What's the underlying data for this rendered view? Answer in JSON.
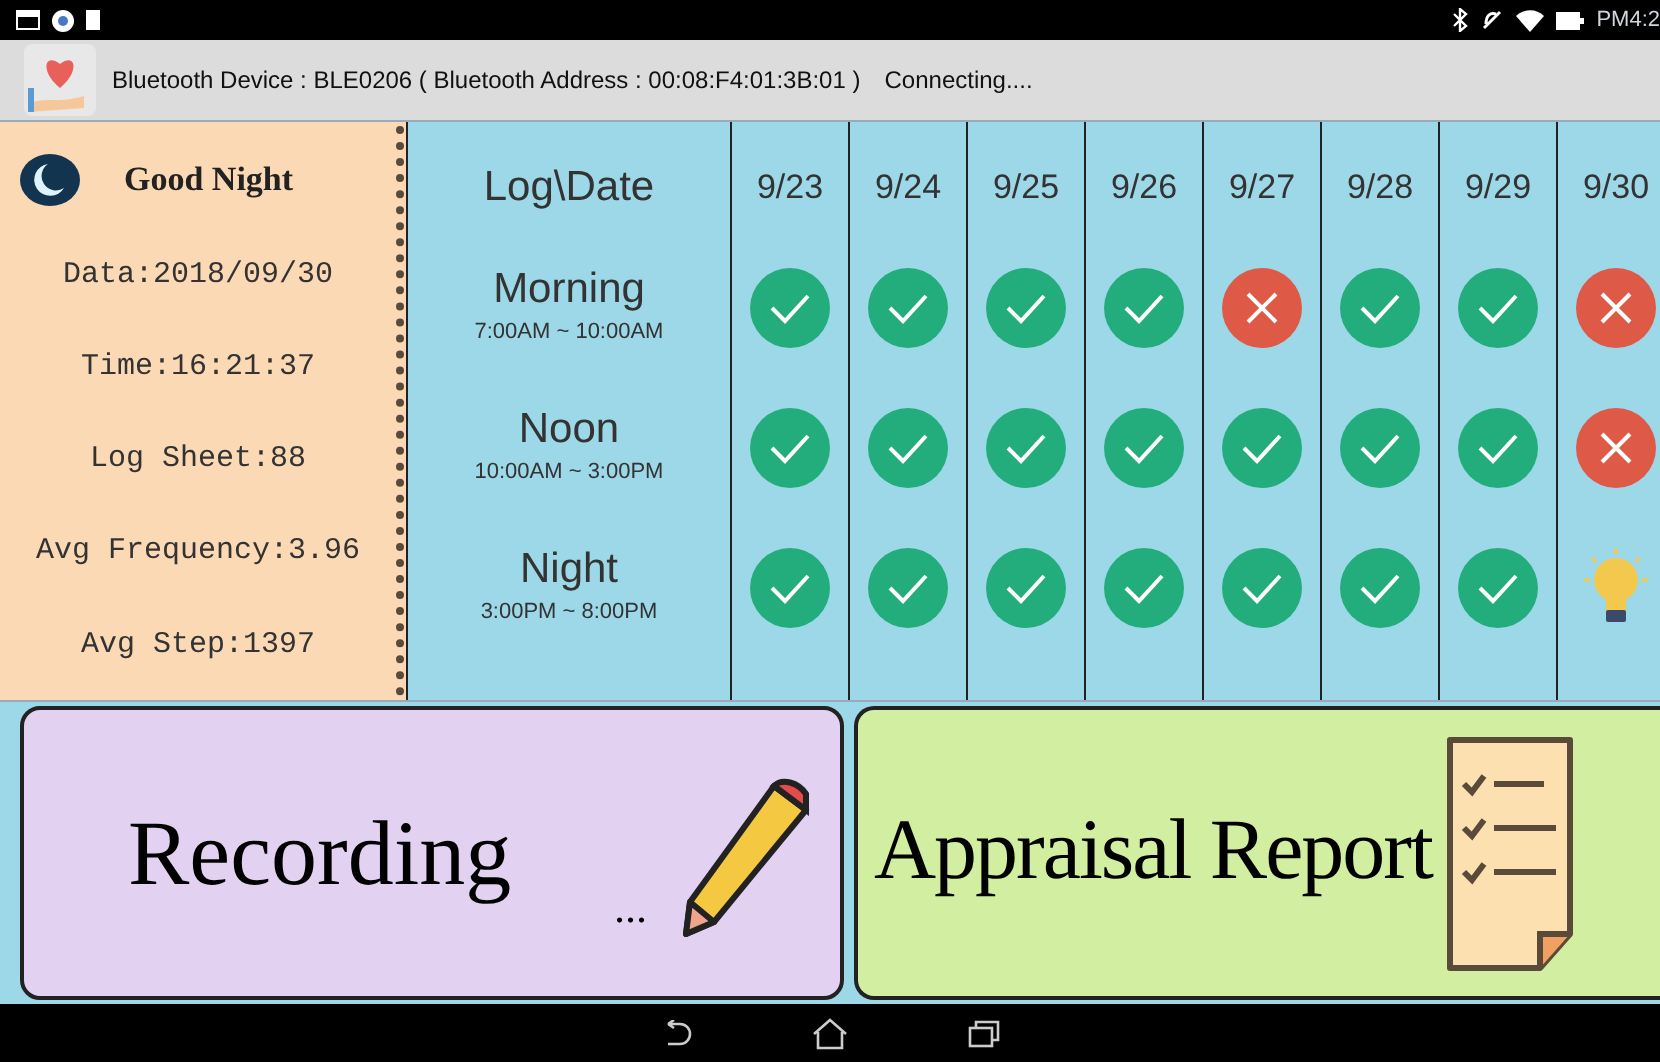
{
  "status_bar": {
    "time": "PM4:2"
  },
  "header": {
    "text": "Bluetooth Device : BLE0206 ( Bluetooth Address : 00:08:F4:01:3B:01 )",
    "status": "Connecting...."
  },
  "summary": {
    "greeting": "Good Night",
    "lines": [
      "Data:2018/09/30",
      "Time:16:21:37",
      "Log Sheet:88",
      "Avg Frequency:3.96",
      "Avg Step:1397"
    ]
  },
  "table": {
    "corner": "Log\\Date",
    "dates": [
      "9/23",
      "9/24",
      "9/25",
      "9/26",
      "9/27",
      "9/28",
      "9/29",
      "9/30"
    ],
    "rows": [
      {
        "name": "Morning",
        "hours": "7:00AM ~ 10:00AM",
        "cells": [
          {
            "kind": "done"
          },
          {
            "kind": "done"
          },
          {
            "kind": "done"
          },
          {
            "kind": "done"
          },
          {
            "kind": "missed"
          },
          {
            "kind": "done"
          },
          {
            "kind": "done"
          },
          {
            "kind": "missed"
          }
        ]
      },
      {
        "name": "Noon",
        "hours": "10:00AM ~ 3:00PM",
        "cells": [
          {
            "kind": "done"
          },
          {
            "kind": "done"
          },
          {
            "kind": "done"
          },
          {
            "kind": "done"
          },
          {
            "kind": "done"
          },
          {
            "kind": "done"
          },
          {
            "kind": "done"
          },
          {
            "kind": "missed"
          }
        ]
      },
      {
        "name": "Night",
        "hours": "3:00PM ~ 8:00PM",
        "cells": [
          {
            "kind": "done"
          },
          {
            "kind": "done"
          },
          {
            "kind": "done"
          },
          {
            "kind": "done"
          },
          {
            "kind": "done"
          },
          {
            "kind": "done"
          },
          {
            "kind": "done"
          },
          {
            "kind": "pending"
          }
        ]
      }
    ]
  },
  "buttons": {
    "recording": "Recording",
    "recording_dots": "...",
    "report": "Appraisal Report"
  }
}
